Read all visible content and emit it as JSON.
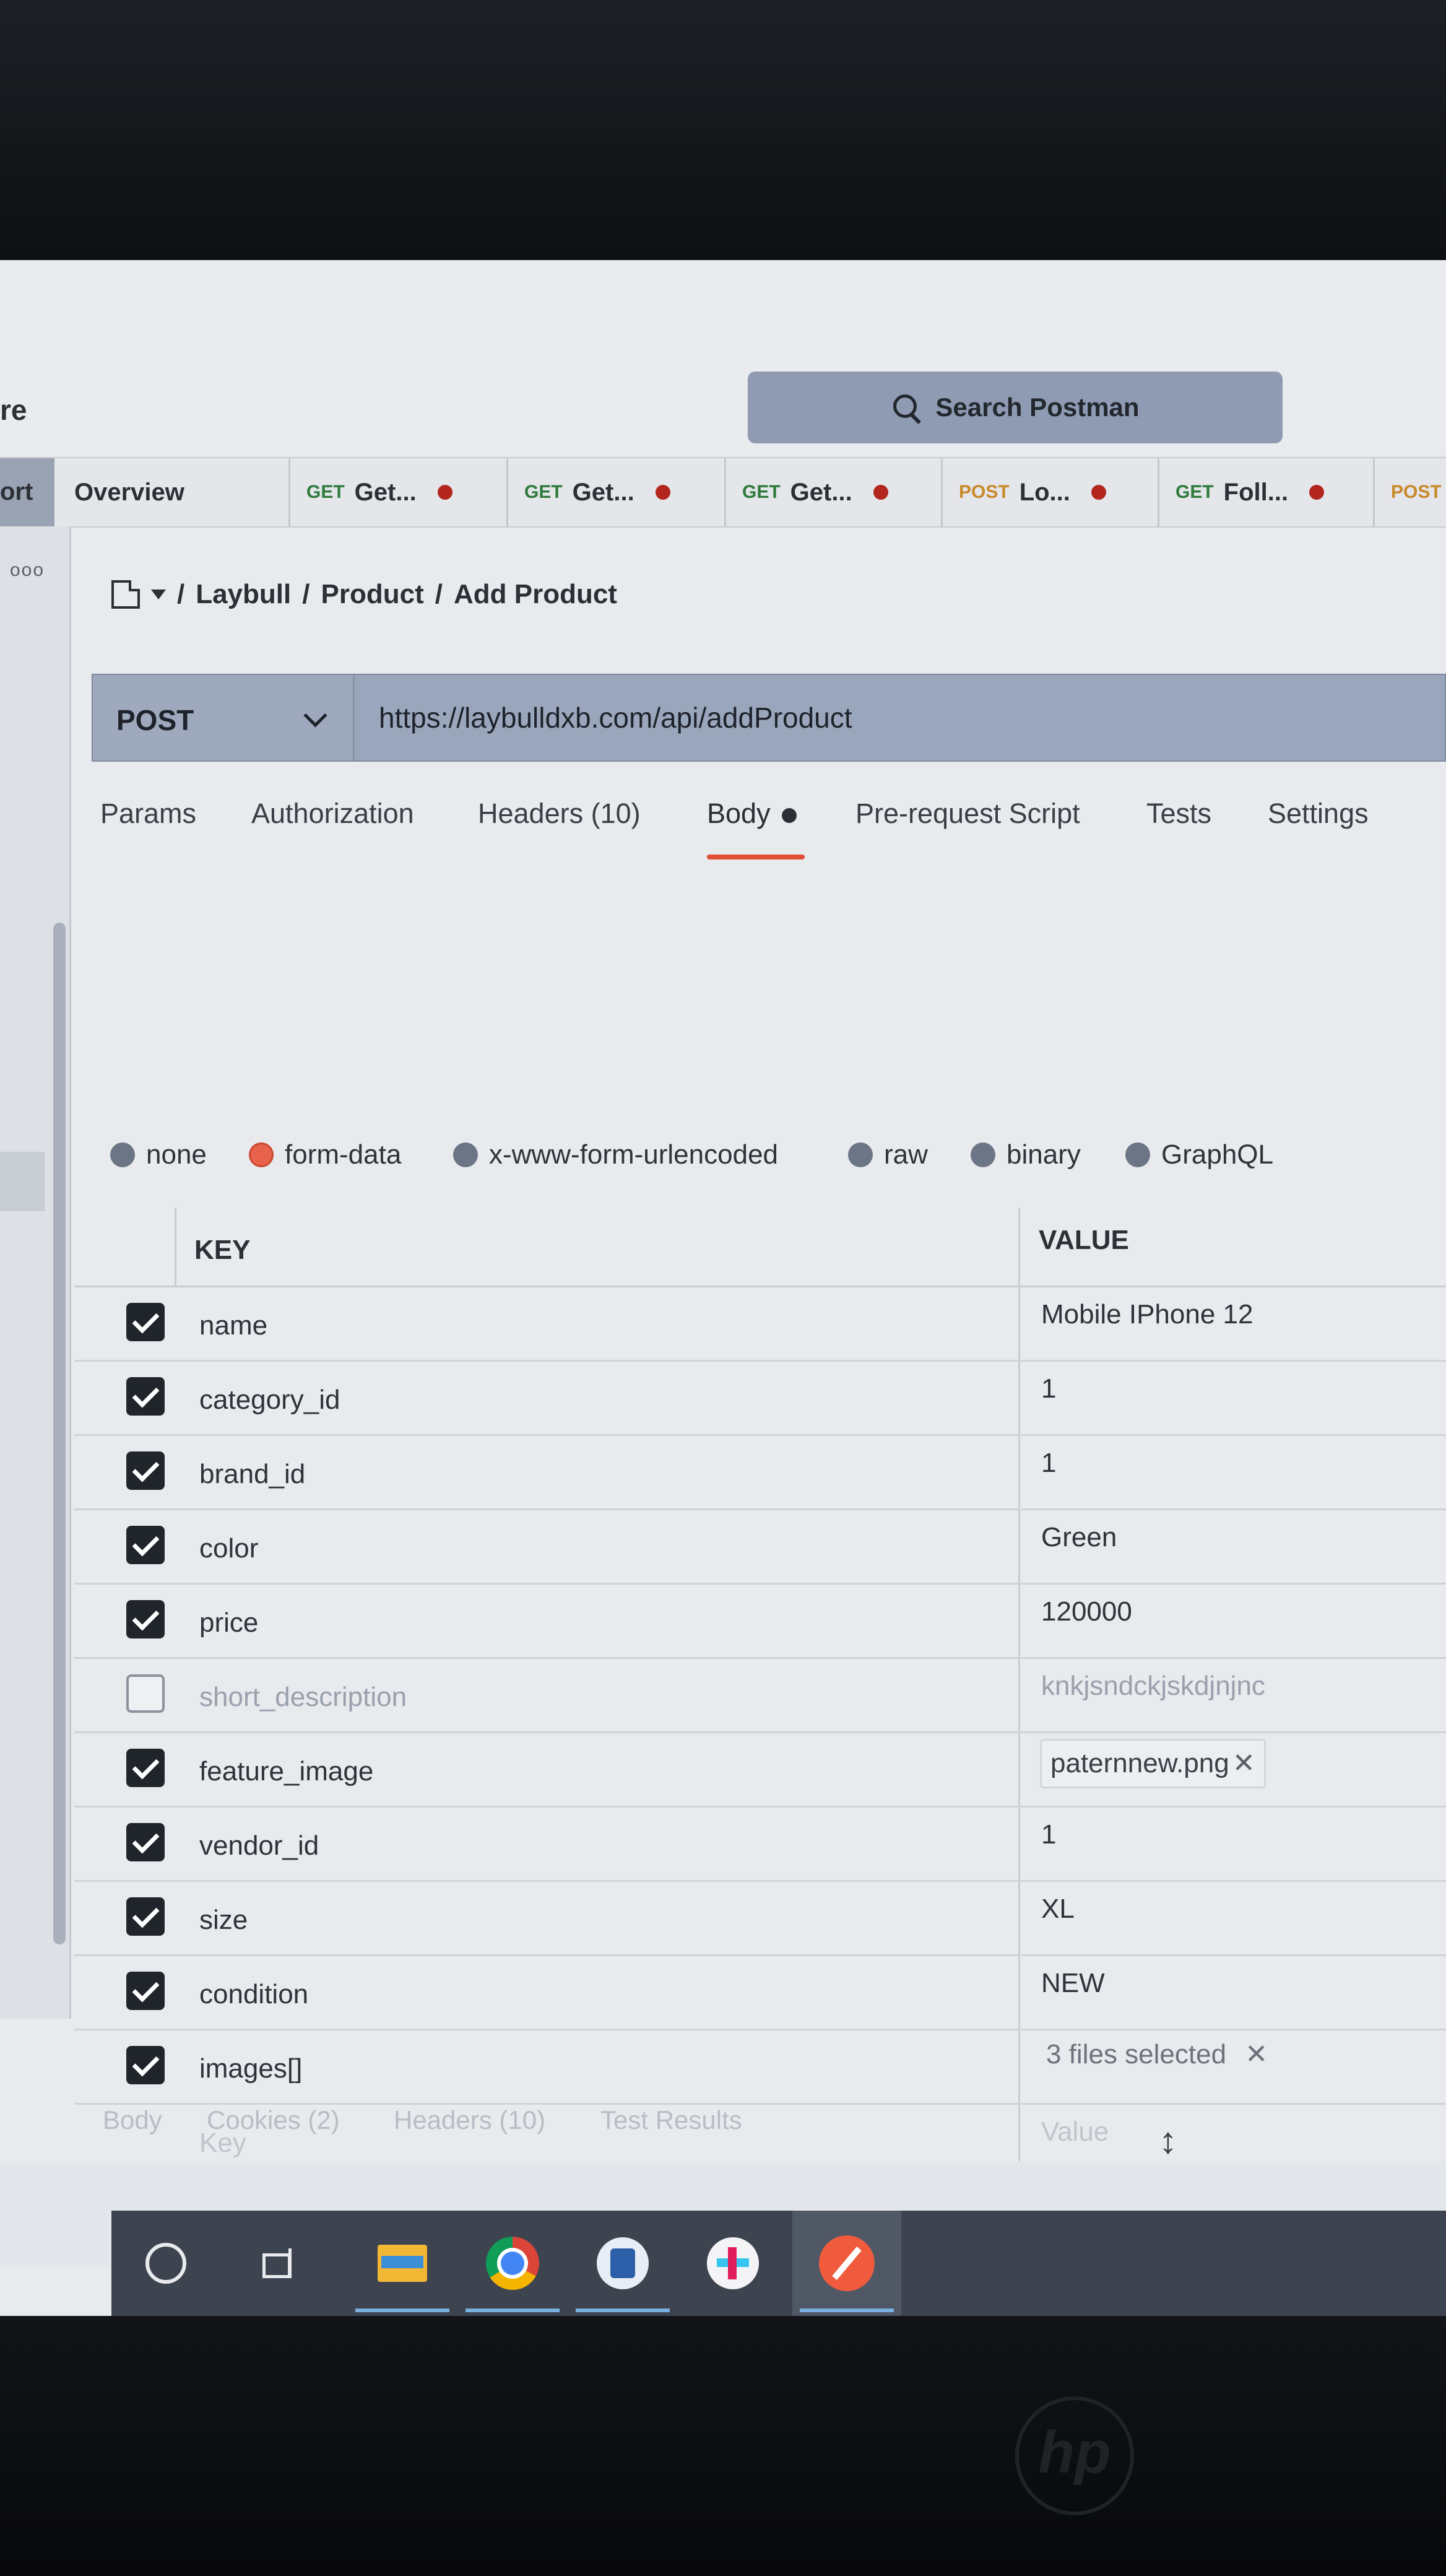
{
  "header": {
    "workspace_fragment": "re",
    "search_label": "Search Postman"
  },
  "tabs": {
    "import_fragment": "ort",
    "overview": "Overview",
    "items": [
      {
        "method": "GET",
        "name": "Get..."
      },
      {
        "method": "GET",
        "name": "Get..."
      },
      {
        "method": "GET",
        "name": "Get..."
      },
      {
        "method": "POST",
        "name": "Lo..."
      },
      {
        "method": "GET",
        "name": "Foll..."
      },
      {
        "method": "POST",
        "name": ""
      }
    ]
  },
  "sidebar": {
    "more": "ooo"
  },
  "breadcrumb": {
    "sep": "/",
    "collection": "Laybull",
    "folder": "Product",
    "request": "Add Product"
  },
  "request": {
    "method": "POST",
    "url": "https://laybulldxb.com/api/addProduct"
  },
  "request_tabs": {
    "params": "Params",
    "authorization": "Authorization",
    "headers": "Headers (10)",
    "body": "Body",
    "pre_request": "Pre-request Script",
    "tests": "Tests",
    "settings": "Settings"
  },
  "body_types": {
    "none": "none",
    "form_data": "form-data",
    "urlencoded": "x-www-form-urlencoded",
    "raw": "raw",
    "binary": "binary",
    "graphql": "GraphQL",
    "selected": "form-data"
  },
  "table": {
    "key_header": "KEY",
    "value_header": "VALUE",
    "rows": [
      {
        "key": "name",
        "value": "Mobile IPhone 12"
      },
      {
        "key": "category_id",
        "value": "1"
      },
      {
        "key": "brand_id",
        "value": "1"
      },
      {
        "key": "color",
        "value": "Green"
      },
      {
        "key": "price",
        "value": "120000"
      },
      {
        "key": "short_description",
        "value": "knkjsndckjskdjnjnc"
      },
      {
        "key": "feature_image",
        "value": "paternnew.png"
      },
      {
        "key": "vendor_id",
        "value": "1"
      },
      {
        "key": "size",
        "value": "XL"
      },
      {
        "key": "condition",
        "value": "NEW"
      },
      {
        "key": "images[]",
        "value": "3 files selected"
      }
    ],
    "key_placeholder": "Key",
    "value_placeholder": "Value"
  },
  "response_tabs": {
    "body": "Body",
    "cookies": "Cookies (2)",
    "headers": "Headers (10)",
    "test_results": "Test Results"
  },
  "colors": {
    "accent": "#e04e36",
    "get": "#2e7a3b",
    "post": "#c98a2a",
    "unsaved_dot": "#b3261e"
  }
}
